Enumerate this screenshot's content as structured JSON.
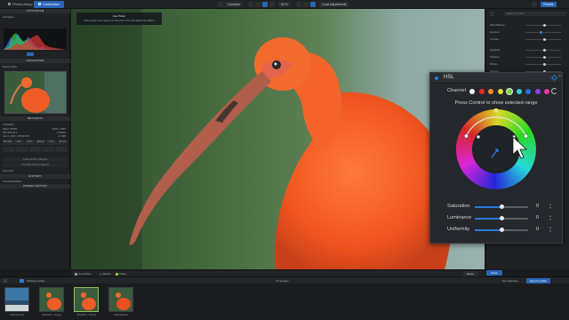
{
  "app": {
    "tabs": [
      {
        "label": "PhotoLibrary"
      },
      {
        "label": "Customize"
      }
    ],
    "compare_label": "Compare",
    "zoom_label": "60 %",
    "local_adjust_label": "Local adjustments",
    "export_label": "Presets"
  },
  "left_panel": {
    "histogram_head": "HISTOGRAM",
    "histogram_label": "Histogram",
    "navigator_head": "NAVIGATION",
    "navigator_label": "Recent Edits",
    "metadata_head": "METADATA",
    "meta_rows": [
      {
        "k": "Full Editor",
        "v": ""
      },
      {
        "k": "Nikon D7500",
        "v": "4000 x 2667"
      },
      {
        "k": "ISO 400 f/6.3",
        "v": "1/1000s"
      },
      {
        "k": "Jan 3, 2021 1:48:52 PM",
        "v": "2.6 MB"
      }
    ],
    "meta_tabs": [
      "ISO 100",
      "1/15",
      "f/4.0",
      "450mm",
      "1.5 x",
      "30 mm"
    ],
    "meta_fields": [
      "Author Anthony Mcguire",
      "Copyright Anthony Mcguire"
    ],
    "keywords_label": "Keywords",
    "history_head": "HISTORY",
    "history_label": "Individual Editing",
    "preset_head": "PRESET EDITOR"
  },
  "tooltip": {
    "title": "Hue Picker",
    "body": "Click to pick a hue range from the photo, then shift adjustment sliders"
  },
  "right_panel": {
    "search_placeholder": "Search for a tool",
    "rows": [
      {
        "label": "White Balance"
      },
      {
        "label": "Exposure"
      },
      {
        "label": "Contrast"
      },
      {
        "label": "Highlights"
      },
      {
        "label": "Shadows"
      },
      {
        "label": "Whites"
      },
      {
        "label": "Vibrancy"
      }
    ]
  },
  "hsl": {
    "title": "HSL",
    "channel_label": "Channel",
    "hint": "Press Control to show selected range",
    "swatches": [
      {
        "color": "#f2f2f2"
      },
      {
        "color": "#e0342f"
      },
      {
        "color": "#f08a24"
      },
      {
        "color": "#eadb35"
      },
      {
        "color": "#7bd23a"
      },
      {
        "color": "#39c9d0"
      },
      {
        "color": "#2f6fe0"
      },
      {
        "color": "#8c45e0"
      },
      {
        "color": "#e03aa6"
      }
    ],
    "sliders": [
      {
        "label": "Saturation",
        "value": "0",
        "fraction": 0.5
      },
      {
        "label": "Luminance",
        "value": "0",
        "fraction": 0.5
      },
      {
        "label": "Uniformity",
        "value": "0",
        "fraction": 0.5
      }
    ]
  },
  "bottom_toolbar": {
    "hue_picker": "Hue Picker",
    "before": "Before",
    "picker": "Picker",
    "cancel": "Reset",
    "apply": "Close"
  },
  "browser": {
    "folder": "Working Folder",
    "count": "1/4 images",
    "my_collection": "My Collection",
    "export": "Export to Disk",
    "thumbs": [
      {
        "label": "JDSC0437.arw"
      },
      {
        "label": "JDSC0437 - 001.jpg"
      },
      {
        "label": "JDSC0437 - 002.jpg"
      },
      {
        "label": "JDSC0438.arw"
      }
    ]
  }
}
